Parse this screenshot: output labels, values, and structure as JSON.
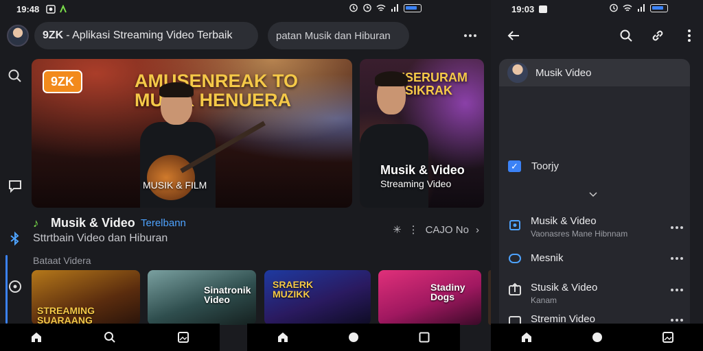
{
  "left_status": {
    "time": "19:48"
  },
  "right_status": {
    "time": "19:03"
  },
  "header": {
    "app_name": "9ZK",
    "title": "- Aplikasi Streaming Video Terbaik",
    "subtitle": "patan Musik dan Hiburan"
  },
  "banners": [
    {
      "logo": "9ZK",
      "title": "AMUSENREAK TO MUSIK HENUERA",
      "caption": "MUSIK & FILM"
    },
    {
      "title": "MUSERURAM MUSIKRAK",
      "caption_title": "Musik & Video",
      "caption_sub": "Streaming Video"
    }
  ],
  "section": {
    "icon": "music-note-icon",
    "title": "Musik & Video",
    "link": "Terelbann",
    "subtitle": "Sttrtbain Video dan Hiburan",
    "tools_label": "CAJO No",
    "list_label": "Bataat Videra"
  },
  "thumbnails": [
    {
      "text": "STREAMING SUARAANG"
    },
    {
      "text": "Sinatronik Video"
    },
    {
      "text": "SRAERK MUZIKK"
    },
    {
      "text": "Stadiny Dogs"
    }
  ],
  "right_panel": {
    "card_title": "Musik Video",
    "check_label": "Toorjy",
    "rows": [
      {
        "icon": "media-icon",
        "title": "Musik & Video",
        "subtitle": "Vaonasres Mane Hibnnam"
      },
      {
        "icon": "cloud-icon",
        "title": "Mesnik",
        "subtitle": ""
      },
      {
        "icon": "upload-box-icon",
        "title": "Stusik & Video",
        "subtitle": "Kanam"
      },
      {
        "icon": "tv-icon",
        "title": "Stremin Video",
        "subtitle": ""
      }
    ]
  },
  "colors": {
    "accent": "#3b82f6",
    "link": "#4ea3ff",
    "title_gold": "#f5c948"
  }
}
